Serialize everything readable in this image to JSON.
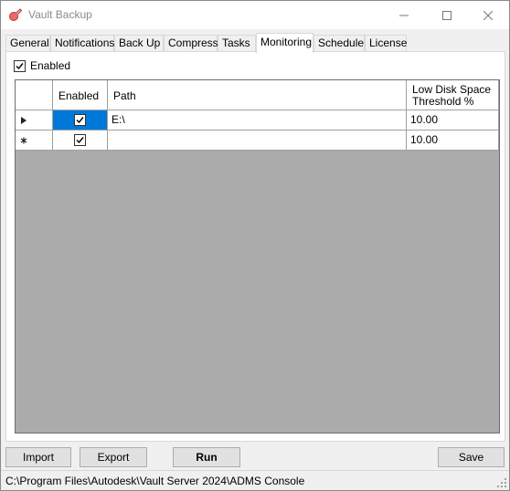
{
  "window": {
    "title": "Vault Backup"
  },
  "tabs": [
    {
      "label": "General"
    },
    {
      "label": "Notifications"
    },
    {
      "label": "Back Up"
    },
    {
      "label": "Compress"
    },
    {
      "label": "Tasks"
    },
    {
      "label": "Monitoring",
      "active": true
    },
    {
      "label": "Schedule"
    },
    {
      "label": "License"
    }
  ],
  "monitoring": {
    "enabled_label": "Enabled",
    "enabled_checked": true,
    "grid": {
      "columns": [
        "Enabled",
        "Path",
        "Low Disk Space Threshold %"
      ],
      "rows": [
        {
          "marker": "current-row",
          "enabled": true,
          "path": "E:\\",
          "threshold": "10.00"
        },
        {
          "marker": "new-row",
          "enabled": true,
          "path": "",
          "threshold": "10.00"
        }
      ]
    }
  },
  "buttons": {
    "import": "Import",
    "export": "Export",
    "run": "Run",
    "save": "Save"
  },
  "status": {
    "path": "C:\\Program Files\\Autodesk\\Vault Server 2024\\ADMS Console"
  }
}
